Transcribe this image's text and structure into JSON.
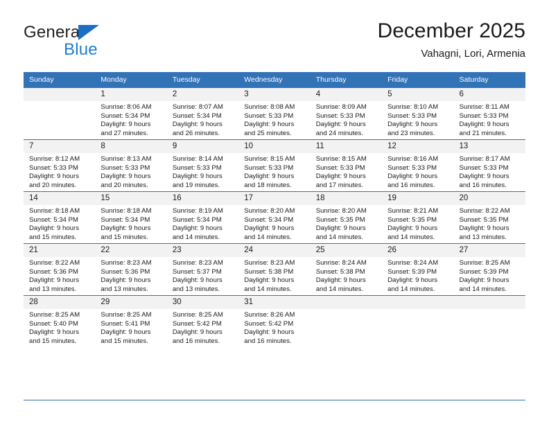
{
  "brand": {
    "name_part1": "General",
    "name_part2": "Blue",
    "triangle_color": "#1b6ec2",
    "blue_color": "#1b7fd4"
  },
  "header": {
    "title": "December 2025",
    "subtitle": "Vahagni, Lori, Armenia"
  },
  "theme": {
    "header_bg": "#3272b7",
    "header_text": "#ffffff",
    "date_band_bg": "#f2f2f2",
    "rule_color": "#3272b7",
    "body_text": "#1a1a1a"
  },
  "calendar": {
    "weekday_headers": [
      "Sunday",
      "Monday",
      "Tuesday",
      "Wednesday",
      "Thursday",
      "Friday",
      "Saturday"
    ],
    "weeks": [
      [
        {
          "date": "",
          "empty": true,
          "lines": []
        },
        {
          "date": "1",
          "lines": [
            "Sunrise: 8:06 AM",
            "Sunset: 5:34 PM",
            "Daylight: 9 hours",
            "and 27 minutes."
          ]
        },
        {
          "date": "2",
          "lines": [
            "Sunrise: 8:07 AM",
            "Sunset: 5:34 PM",
            "Daylight: 9 hours",
            "and 26 minutes."
          ]
        },
        {
          "date": "3",
          "lines": [
            "Sunrise: 8:08 AM",
            "Sunset: 5:33 PM",
            "Daylight: 9 hours",
            "and 25 minutes."
          ]
        },
        {
          "date": "4",
          "lines": [
            "Sunrise: 8:09 AM",
            "Sunset: 5:33 PM",
            "Daylight: 9 hours",
            "and 24 minutes."
          ]
        },
        {
          "date": "5",
          "lines": [
            "Sunrise: 8:10 AM",
            "Sunset: 5:33 PM",
            "Daylight: 9 hours",
            "and 23 minutes."
          ]
        },
        {
          "date": "6",
          "lines": [
            "Sunrise: 8:11 AM",
            "Sunset: 5:33 PM",
            "Daylight: 9 hours",
            "and 21 minutes."
          ]
        }
      ],
      [
        {
          "date": "7",
          "lines": [
            "Sunrise: 8:12 AM",
            "Sunset: 5:33 PM",
            "Daylight: 9 hours",
            "and 20 minutes."
          ]
        },
        {
          "date": "8",
          "lines": [
            "Sunrise: 8:13 AM",
            "Sunset: 5:33 PM",
            "Daylight: 9 hours",
            "and 20 minutes."
          ]
        },
        {
          "date": "9",
          "lines": [
            "Sunrise: 8:14 AM",
            "Sunset: 5:33 PM",
            "Daylight: 9 hours",
            "and 19 minutes."
          ]
        },
        {
          "date": "10",
          "lines": [
            "Sunrise: 8:15 AM",
            "Sunset: 5:33 PM",
            "Daylight: 9 hours",
            "and 18 minutes."
          ]
        },
        {
          "date": "11",
          "lines": [
            "Sunrise: 8:15 AM",
            "Sunset: 5:33 PM",
            "Daylight: 9 hours",
            "and 17 minutes."
          ]
        },
        {
          "date": "12",
          "lines": [
            "Sunrise: 8:16 AM",
            "Sunset: 5:33 PM",
            "Daylight: 9 hours",
            "and 16 minutes."
          ]
        },
        {
          "date": "13",
          "lines": [
            "Sunrise: 8:17 AM",
            "Sunset: 5:33 PM",
            "Daylight: 9 hours",
            "and 16 minutes."
          ]
        }
      ],
      [
        {
          "date": "14",
          "lines": [
            "Sunrise: 8:18 AM",
            "Sunset: 5:34 PM",
            "Daylight: 9 hours",
            "and 15 minutes."
          ]
        },
        {
          "date": "15",
          "lines": [
            "Sunrise: 8:18 AM",
            "Sunset: 5:34 PM",
            "Daylight: 9 hours",
            "and 15 minutes."
          ]
        },
        {
          "date": "16",
          "lines": [
            "Sunrise: 8:19 AM",
            "Sunset: 5:34 PM",
            "Daylight: 9 hours",
            "and 14 minutes."
          ]
        },
        {
          "date": "17",
          "lines": [
            "Sunrise: 8:20 AM",
            "Sunset: 5:34 PM",
            "Daylight: 9 hours",
            "and 14 minutes."
          ]
        },
        {
          "date": "18",
          "lines": [
            "Sunrise: 8:20 AM",
            "Sunset: 5:35 PM",
            "Daylight: 9 hours",
            "and 14 minutes."
          ]
        },
        {
          "date": "19",
          "lines": [
            "Sunrise: 8:21 AM",
            "Sunset: 5:35 PM",
            "Daylight: 9 hours",
            "and 14 minutes."
          ]
        },
        {
          "date": "20",
          "lines": [
            "Sunrise: 8:22 AM",
            "Sunset: 5:35 PM",
            "Daylight: 9 hours",
            "and 13 minutes."
          ]
        }
      ],
      [
        {
          "date": "21",
          "lines": [
            "Sunrise: 8:22 AM",
            "Sunset: 5:36 PM",
            "Daylight: 9 hours",
            "and 13 minutes."
          ]
        },
        {
          "date": "22",
          "lines": [
            "Sunrise: 8:23 AM",
            "Sunset: 5:36 PM",
            "Daylight: 9 hours",
            "and 13 minutes."
          ]
        },
        {
          "date": "23",
          "lines": [
            "Sunrise: 8:23 AM",
            "Sunset: 5:37 PM",
            "Daylight: 9 hours",
            "and 13 minutes."
          ]
        },
        {
          "date": "24",
          "lines": [
            "Sunrise: 8:23 AM",
            "Sunset: 5:38 PM",
            "Daylight: 9 hours",
            "and 14 minutes."
          ]
        },
        {
          "date": "25",
          "lines": [
            "Sunrise: 8:24 AM",
            "Sunset: 5:38 PM",
            "Daylight: 9 hours",
            "and 14 minutes."
          ]
        },
        {
          "date": "26",
          "lines": [
            "Sunrise: 8:24 AM",
            "Sunset: 5:39 PM",
            "Daylight: 9 hours",
            "and 14 minutes."
          ]
        },
        {
          "date": "27",
          "lines": [
            "Sunrise: 8:25 AM",
            "Sunset: 5:39 PM",
            "Daylight: 9 hours",
            "and 14 minutes."
          ]
        }
      ],
      [
        {
          "date": "28",
          "lines": [
            "Sunrise: 8:25 AM",
            "Sunset: 5:40 PM",
            "Daylight: 9 hours",
            "and 15 minutes."
          ]
        },
        {
          "date": "29",
          "lines": [
            "Sunrise: 8:25 AM",
            "Sunset: 5:41 PM",
            "Daylight: 9 hours",
            "and 15 minutes."
          ]
        },
        {
          "date": "30",
          "lines": [
            "Sunrise: 8:25 AM",
            "Sunset: 5:42 PM",
            "Daylight: 9 hours",
            "and 16 minutes."
          ]
        },
        {
          "date": "31",
          "lines": [
            "Sunrise: 8:26 AM",
            "Sunset: 5:42 PM",
            "Daylight: 9 hours",
            "and 16 minutes."
          ]
        },
        {
          "date": "",
          "empty": true,
          "lines": []
        },
        {
          "date": "",
          "empty": true,
          "lines": []
        },
        {
          "date": "",
          "empty": true,
          "lines": []
        }
      ]
    ]
  }
}
